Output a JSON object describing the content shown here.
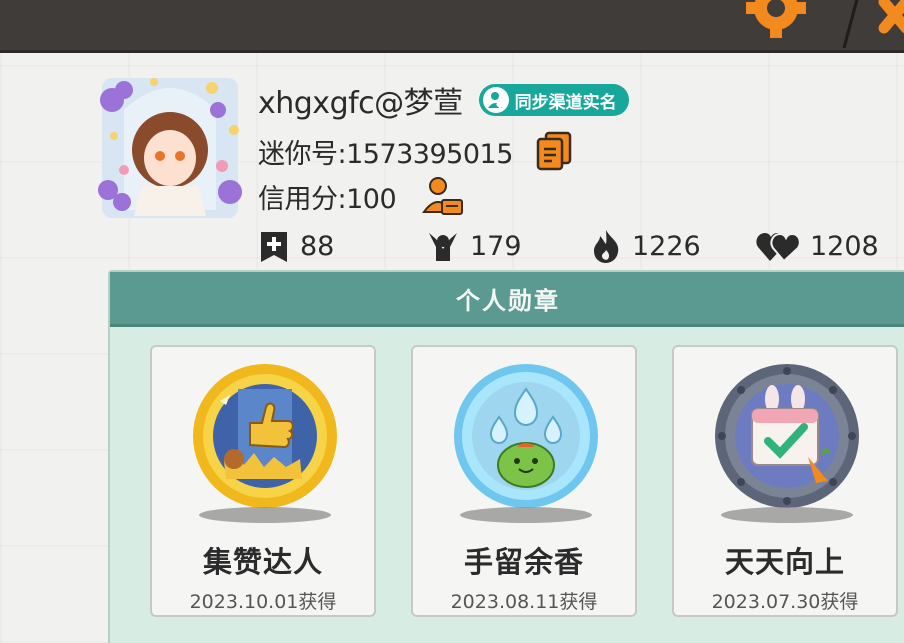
{
  "profile": {
    "username": "xhgxgfc@梦萱",
    "verify_label": "同步渠道实名",
    "mini_id": "迷你号:1573395015",
    "credit": "信用分:100"
  },
  "stats": [
    {
      "icon": "post-plus-icon",
      "value": "88"
    },
    {
      "icon": "fans-icon",
      "value": "179"
    },
    {
      "icon": "fire-icon",
      "value": "1226"
    },
    {
      "icon": "hearts-icon",
      "value": "1208"
    }
  ],
  "badges_panel": {
    "title": "个人勋章",
    "badges": [
      {
        "name": "集赞达人",
        "date": "2023.10.01获得",
        "style": "gold-thumbs-up"
      },
      {
        "name": "手留余香",
        "date": "2023.08.11获得",
        "style": "crystal-water-drops"
      },
      {
        "name": "天天向上",
        "date": "2023.07.30获得",
        "style": "steel-calendar-check"
      }
    ]
  },
  "colors": {
    "topbar": "#3f3c3a",
    "accent_orange": "#f28a1e",
    "verify_teal": "#17a79b",
    "panel_header": "#5a9a90",
    "panel_bg": "#d7ece3"
  }
}
